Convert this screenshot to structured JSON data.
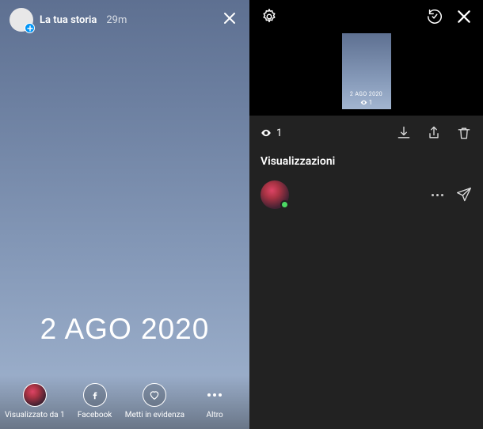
{
  "left": {
    "title": "La tua storia",
    "time": "29m",
    "caption": "2 AGO 2020",
    "footer": {
      "viewed_by": "Visualizzato da 1",
      "facebook": "Facebook",
      "highlight": "Metti in evidenza",
      "more": "Altro"
    }
  },
  "right": {
    "thumb_caption": "2 AGO 2020",
    "thumb_views": "1",
    "view_count": "1",
    "section_title": "Visualizzazioni"
  }
}
